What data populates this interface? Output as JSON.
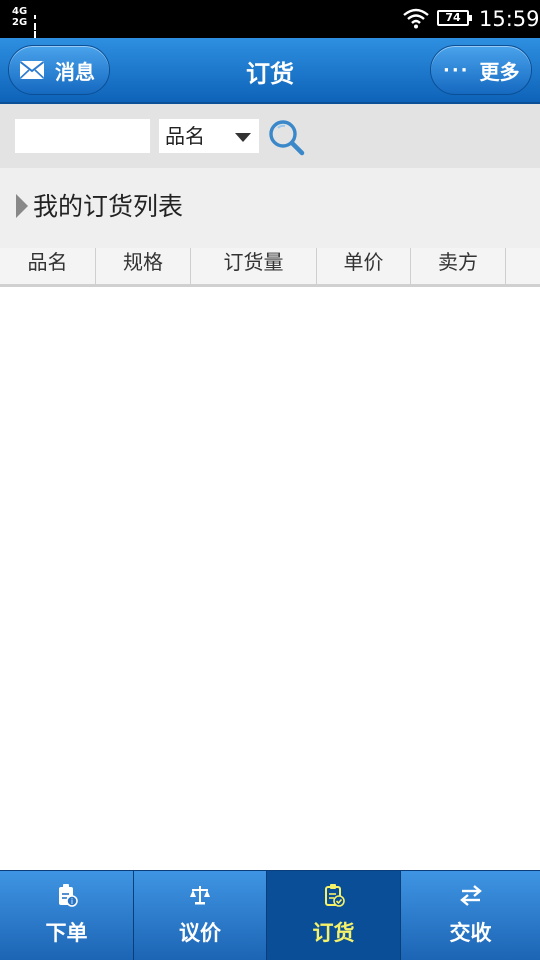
{
  "status_bar": {
    "network": "4G\n2G",
    "battery": "74",
    "time": "15:59"
  },
  "header": {
    "title": "订货",
    "left_button": "消息",
    "right_button": "更多",
    "right_button_icon_text": "···"
  },
  "search": {
    "input_value": "",
    "select_value": "品名"
  },
  "section": {
    "title": "我的订货列表"
  },
  "table": {
    "columns": [
      "品名",
      "规格",
      "订货量",
      "单价",
      "卖方"
    ]
  },
  "tabs": [
    {
      "label": "下单",
      "icon": "order-clipboard-icon",
      "active": false
    },
    {
      "label": "议价",
      "icon": "balance-scale-icon",
      "active": false
    },
    {
      "label": "订货",
      "icon": "booking-clipboard-icon",
      "active": true
    },
    {
      "label": "交收",
      "icon": "swap-arrows-icon",
      "active": false
    }
  ],
  "colors": {
    "header": "#1a72c8",
    "tab_active": "#0b4e98",
    "tab_active_text": "#f5f26a"
  }
}
